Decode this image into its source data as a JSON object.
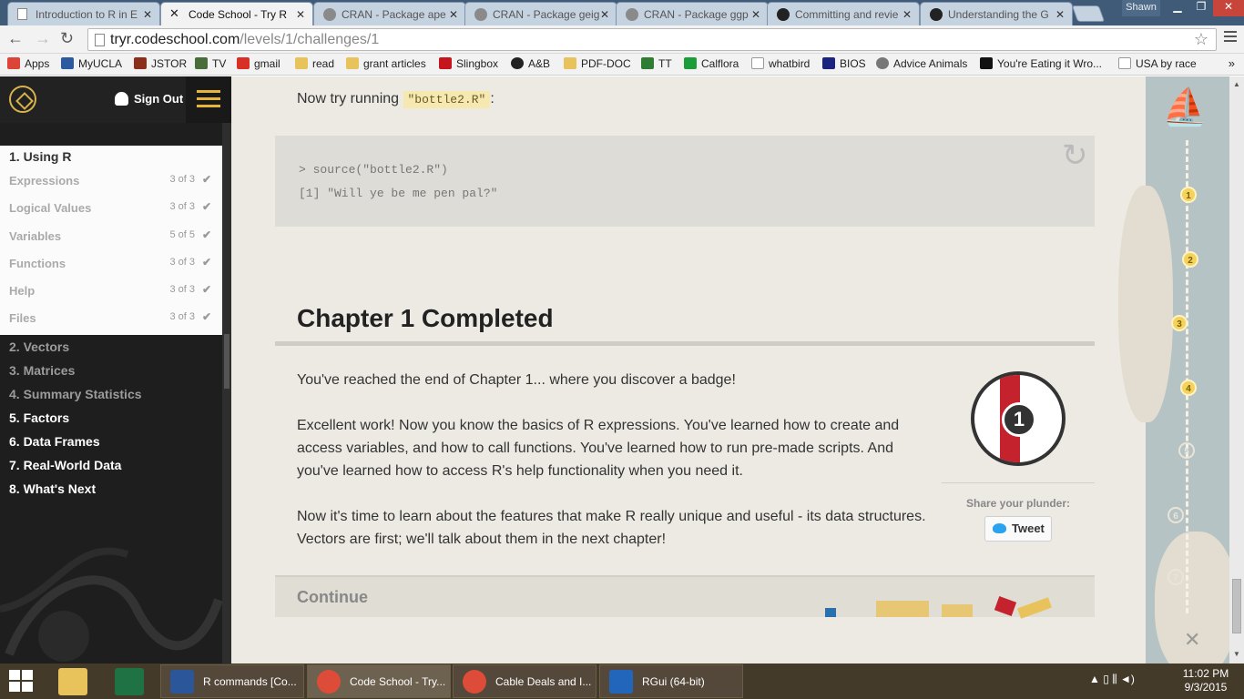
{
  "browser": {
    "tabs": [
      {
        "label": "Introduction to R in E",
        "icon": "doc-icon",
        "active": false
      },
      {
        "label": "Code School - Try R",
        "icon": "codeschool-icon",
        "active": true
      },
      {
        "label": "CRAN - Package ape",
        "icon": "r-icon",
        "active": false
      },
      {
        "label": "CRAN - Package geig",
        "icon": "r-icon",
        "active": false
      },
      {
        "label": "CRAN - Package ggp",
        "icon": "r-icon",
        "active": false
      },
      {
        "label": "Committing and revie",
        "icon": "github-icon",
        "active": false
      },
      {
        "label": "Understanding the G",
        "icon": "github-icon",
        "active": false
      }
    ],
    "close_glyph": "✕",
    "user": "Shawn",
    "url_host": "tryr.codeschool.com",
    "url_path": "/levels/1/challenges/1",
    "bookmarks": [
      {
        "label": "Apps",
        "color": "#db4437"
      },
      {
        "label": "MyUCLA",
        "color": "#2c5aa0"
      },
      {
        "label": "JSTOR",
        "color": "#8b2e1a"
      },
      {
        "label": "TV",
        "color": "#4a6b3a"
      },
      {
        "label": "gmail",
        "color": "#d93025"
      },
      {
        "label": "read",
        "color": "#e8c25a"
      },
      {
        "label": "grant articles",
        "color": "#e8c25a"
      },
      {
        "label": "Slingbox",
        "color": "#c4161c"
      },
      {
        "label": "A&B",
        "color": "#222222"
      },
      {
        "label": "PDF-DOC",
        "color": "#e8c25a"
      },
      {
        "label": "TT",
        "color": "#2e7d32"
      },
      {
        "label": "Calflora",
        "color": "#1b9e3a"
      },
      {
        "label": "whatbird",
        "color": "#dddddd"
      },
      {
        "label": "BIOS",
        "color": "#1a237e"
      },
      {
        "label": "Advice Animals",
        "color": "#777777"
      },
      {
        "label": "You're Eating it Wro...",
        "color": "#111111"
      },
      {
        "label": "USA by race",
        "color": "#dddddd"
      }
    ],
    "bookmarks_more": "»"
  },
  "sidebar": {
    "signout_label": "Sign Out",
    "active_level": "1. Using R",
    "lessons": [
      {
        "label": "Expressions",
        "count": "3 of 3"
      },
      {
        "label": "Logical Values",
        "count": "3 of 3"
      },
      {
        "label": "Variables",
        "count": "5 of 5"
      },
      {
        "label": "Functions",
        "count": "3 of 3"
      },
      {
        "label": "Help",
        "count": "3 of 3"
      },
      {
        "label": "Files",
        "count": "3 of 3"
      }
    ],
    "check_glyph": "✔",
    "levels": [
      {
        "label": "2. Vectors",
        "color": "#9b9b9b"
      },
      {
        "label": "3. Matrices",
        "color": "#9b9b9b"
      },
      {
        "label": "4. Summary Statistics",
        "color": "#9b9b9b"
      },
      {
        "label": "5. Factors",
        "color": "#ffffff"
      },
      {
        "label": "6. Data Frames",
        "color": "#ffffff"
      },
      {
        "label": "7. Real-World Data",
        "color": "#ffffff"
      },
      {
        "label": "8. What's Next",
        "color": "#ffffff"
      }
    ]
  },
  "main": {
    "try_prefix": "Now try running ",
    "try_code": "\"bottle2.R\"",
    "try_suffix": ":",
    "console_lines": [
      "> source(\"bottle2.R\")",
      "[1] \"Will ye be me pen pal?\""
    ],
    "chapter_title": "Chapter 1 Completed",
    "paragraphs": [
      "You've reached the end of Chapter 1... where you discover a badge!",
      "Excellent work! Now you know the basics of R expressions. You've learned how to create and access variables, and how to call functions. You've learned how to run pre-made scripts. And you've learned how to access R's help functionality when you need it.",
      "Now it's time to learn about the features that make R really unique and useful - its data structures. Vectors are first; we'll talk about them in the next chapter!"
    ],
    "badge_number": "1",
    "share_label": "Share your plunder:",
    "tweet_label": "Tweet",
    "continue_label": "Continue"
  },
  "map": {
    "stops": [
      {
        "label": "1",
        "done": true
      },
      {
        "label": "2",
        "done": true
      },
      {
        "label": "3",
        "done": true
      },
      {
        "label": "4",
        "done": true
      },
      {
        "label": "5",
        "done": false
      },
      {
        "label": "6",
        "done": false
      },
      {
        "label": "7",
        "done": false
      }
    ],
    "end_mark": "✕"
  },
  "taskbar": {
    "buttons": [
      {
        "label": "R commands [Co...",
        "icon": "word-icon",
        "color": "#2b579a"
      },
      {
        "label": "Code School - Try...",
        "icon": "chrome-icon",
        "color": "#dd4b39"
      },
      {
        "label": "Cable Deals and I...",
        "icon": "chrome-icon",
        "color": "#dd4b39"
      },
      {
        "label": "RGui (64-bit)",
        "icon": "r-icon",
        "color": "#2266bb"
      }
    ],
    "tray_icons": "▲ ▯ ⫼ ◄)",
    "time": "11:02 PM",
    "date": "9/3/2015"
  }
}
